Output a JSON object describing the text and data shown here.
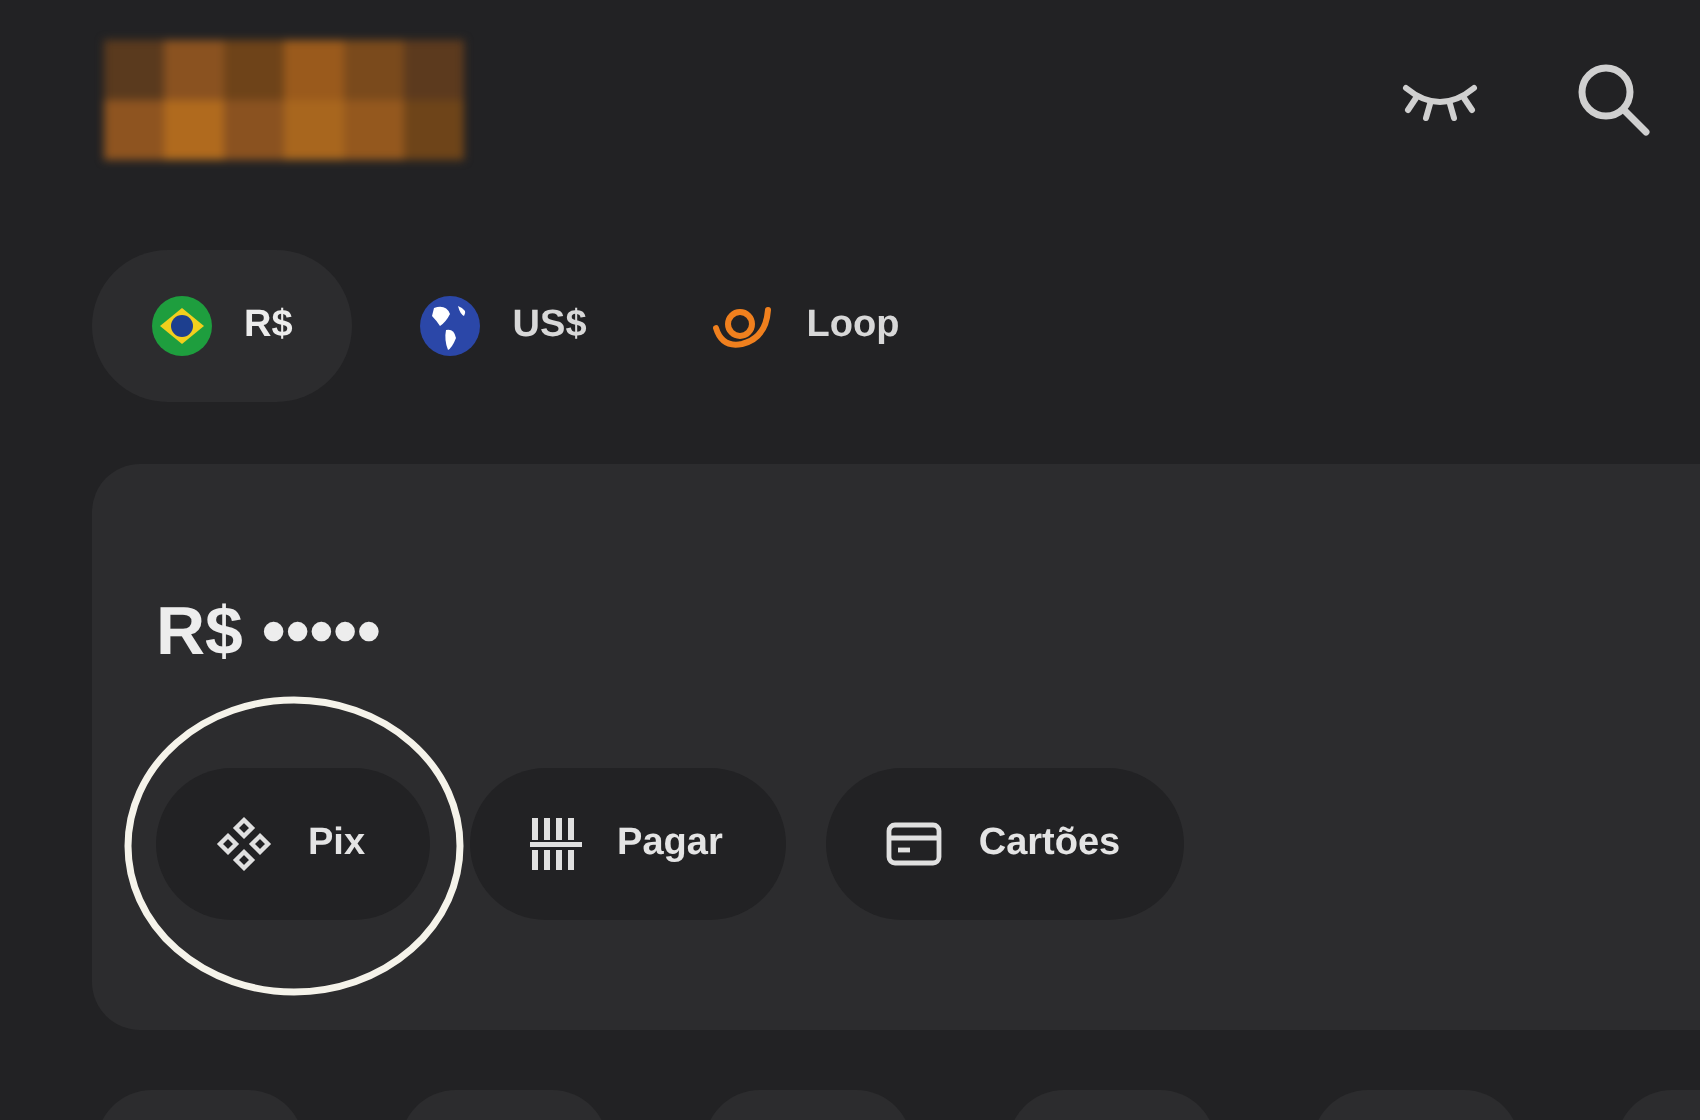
{
  "currencies": [
    {
      "label": "R$",
      "kind": "brl",
      "selected": true
    },
    {
      "label": "US$",
      "kind": "usd",
      "selected": false
    },
    {
      "label": "Loop",
      "kind": "loop",
      "selected": false
    }
  ],
  "balance": "R$ •••••",
  "actions": [
    {
      "label": "Pix",
      "kind": "pix",
      "highlighted": true
    },
    {
      "label": "Pagar",
      "kind": "barcode",
      "highlighted": false
    },
    {
      "label": "Cartões",
      "kind": "card",
      "highlighted": false
    }
  ]
}
